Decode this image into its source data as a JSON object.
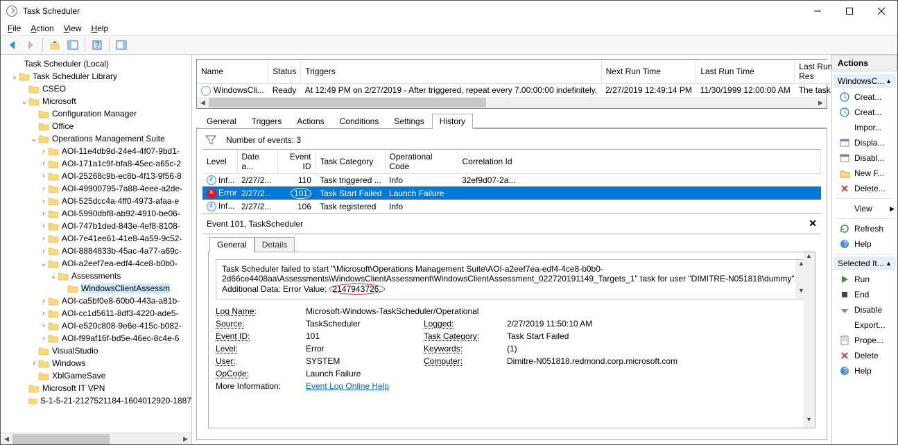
{
  "window": {
    "title": "Task Scheduler"
  },
  "menus": {
    "file": "File",
    "action": "Action",
    "view": "View",
    "help": "Help"
  },
  "tree": {
    "root": "Task Scheduler (Local)",
    "lib": "Task Scheduler Library",
    "cseo": "CSEO",
    "microsoft": "Microsoft",
    "cfgmgr": "Configuration Manager",
    "office": "Office",
    "oms": "Operations Management Suite",
    "aoi": [
      "AOI-11e4db9d-24e4-4f07-9bd1-",
      "AOI-171a1c9f-bfa8-45ec-a65c-2",
      "AOI-25268c9b-ec8b-4f13-9f56-8",
      "AOI-49900795-7a88-4eee-a2de-",
      "AOI-525dcc4a-4ff0-4973-afaa-e",
      "AOI-5990dbf8-ab92-4910-be06-",
      "AOI-747b1ded-843e-4ef8-8108-",
      "AOI-7e41ee61-41e8-4a59-9c52-",
      "AOI-8884833b-45ac-4a77-a69c-",
      "AOI-a2eef7ea-edf4-4ce8-b0b0-",
      "AOI-ca5bf0e8-60b0-443a-a81b-",
      "AOI-cc1d5611-8df3-4220-ade5-",
      "AOI-e520c808-9e6e-415c-b082-",
      "AOI-f99af16f-bd5e-46ec-8c4e-6"
    ],
    "assessments": "Assessments",
    "wca": "WindowsClientAssessm",
    "vs": "VisualStudio",
    "windows": "Windows",
    "xbl": "XblGameSave",
    "vpn": "Microsoft IT VPN",
    "sid": "S-1-5-21-2127521184-1604012920-1887"
  },
  "taskTable": {
    "cols": [
      "Name",
      "Status",
      "Triggers",
      "Next Run Time",
      "Last Run Time",
      "Last Run Res"
    ],
    "row": {
      "name": "WindowsCli...",
      "status": "Ready",
      "triggers": "At 12:49 PM on 2/27/2019 - After triggered, repeat every 7.00:00:00 indefinitely.",
      "next": "2/27/2019 12:49:14 PM",
      "last": "11/30/1999 12:00:00 AM",
      "result": "The task has"
    }
  },
  "tabs": [
    "General",
    "Triggers",
    "Actions",
    "Conditions",
    "Settings",
    "History"
  ],
  "events": {
    "filterLabel": "Number of events: 3",
    "cols": [
      "Level",
      "Date a...",
      "Event ID",
      "Task Category",
      "Operational Code",
      "Correlation Id"
    ],
    "rows": [
      {
        "level": "Inf...",
        "date": "2/27/2...",
        "id": "110",
        "cat": "Task triggered ...",
        "op": "Info",
        "cor": "32ef9d07-2a..."
      },
      {
        "level": "Error",
        "date": "2/27/2...",
        "id": "101",
        "cat": "Task Start Failed",
        "op": "Launch Failure",
        "cor": ""
      },
      {
        "level": "Inf...",
        "date": "2/27/2...",
        "id": "106",
        "cat": "Task registered",
        "op": "Info",
        "cor": ""
      }
    ]
  },
  "detail": {
    "title": "Event 101, TaskScheduler",
    "subtabs": [
      "General",
      "Details"
    ],
    "desc1": "Task Scheduler failed to start \"\\Microsoft\\Operations Management Suite\\AOI-a2eef7ea-edf4-4ce8-b0b0-2d66ce4408aa\\Assessments\\WindowsClientAssessment\\WindowsClientAssessment_022720191149_Targets_1\" task for user \"DIMITRE-N051818\\dummy\". Additional Data: Error Value:",
    "desc2": "2147943726.",
    "props": {
      "logNameK": "Log Name:",
      "logName": "Microsoft-Windows-TaskScheduler/Operational",
      "sourceK": "Source:",
      "source": "TaskScheduler",
      "loggedK": "Logged:",
      "logged": "2/27/2019 11:50:10 AM",
      "eventIdK": "Event ID:",
      "eventId": "101",
      "taskCatK": "Task Category:",
      "taskCat": "Task Start Failed",
      "levelK": "Level:",
      "level": "Error",
      "keywordsK": "Keywords:",
      "keywords": "(1)",
      "userK": "User:",
      "user": "SYSTEM",
      "computerK": "Computer:",
      "computer": "Dimitre-N051818.redmond.corp.microsoft.com",
      "opcodeK": "OpCode:",
      "opcode": "Launch Failure",
      "moreK": "More Information:",
      "moreLink": "Event Log Online Help"
    }
  },
  "actions": {
    "title": "Actions",
    "group1": "WindowsC...",
    "g1items": [
      "Creat...",
      "Creat...",
      "Impor...",
      "Displa...",
      "Disabl...",
      "New F...",
      "Delete...",
      "View",
      "Refresh",
      "Help"
    ],
    "group2": "Selected It...",
    "g2items": [
      "Run",
      "End",
      "Disable",
      "Export...",
      "Prope...",
      "Delete",
      "Help"
    ]
  }
}
